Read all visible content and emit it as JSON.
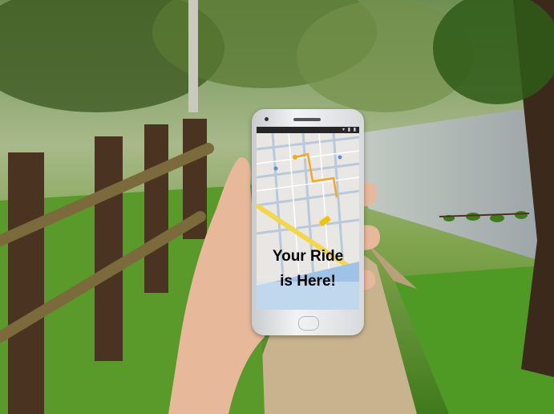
{
  "scene": {
    "description_colors": {
      "grass": "#5a9a2a",
      "path": "#c9b38f",
      "fence": "#4a3320",
      "sky_glow": "#d8e6c0",
      "road": "#9aa3a6"
    }
  },
  "phone": {
    "status_icons": "▾ ▮ ▮",
    "screen_message_line1": "Your Ride",
    "screen_message_line2": "is Here!",
    "accent_taxi": "#f2c200",
    "route_color": "#f5a623"
  }
}
